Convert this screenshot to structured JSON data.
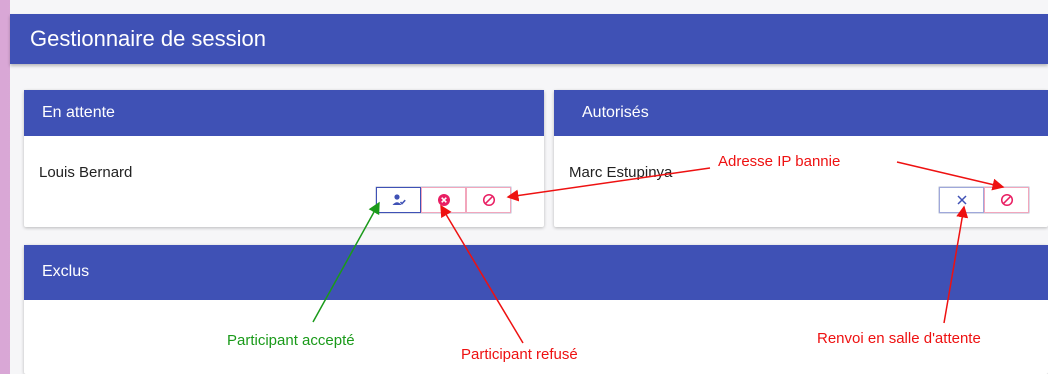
{
  "app": {
    "title": "Gestionnaire de session"
  },
  "panels": {
    "waiting": {
      "title": "En attente",
      "participant": "Louis Bernard"
    },
    "authorized": {
      "title": "Autorisés",
      "participant": "Marc Estupinya"
    },
    "excluded": {
      "title": "Exclus"
    }
  },
  "annotations": {
    "banned_ip": "Adresse IP bannie",
    "accepted": "Participant accepté",
    "refused": "Participant refusé",
    "back_to_waiting": "Renvoi en salle d'attente"
  },
  "icons": {
    "accept": "person-check-icon",
    "refuse": "cancel-circle-icon",
    "ban": "block-icon",
    "back": "close-icon"
  },
  "colors": {
    "primary": "#3f51b5",
    "danger": "#e91e63",
    "annotation_red": "#e11111",
    "annotation_green": "#1a9a1a"
  }
}
